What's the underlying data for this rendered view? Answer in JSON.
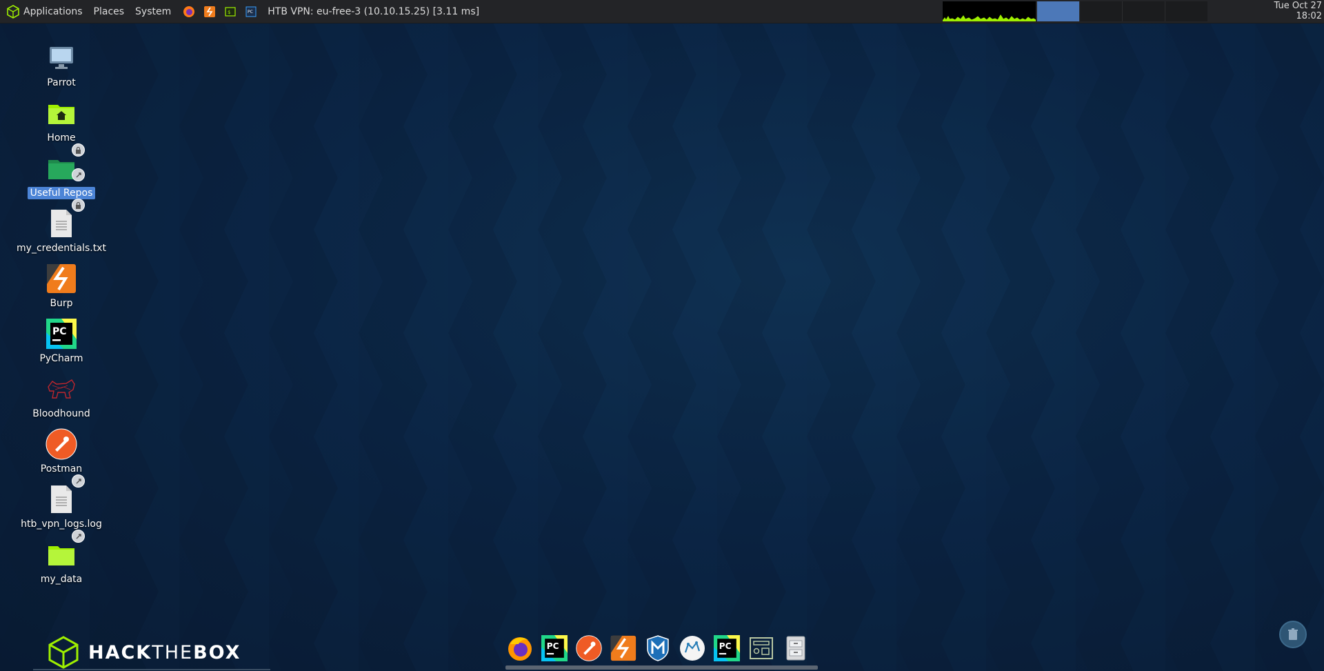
{
  "panel": {
    "menus": [
      "Applications",
      "Places",
      "System"
    ],
    "vpn_status": "HTB VPN: eu-free-3 (10.10.15.25) [3.11 ms]",
    "clock_date": "Tue Oct 27",
    "clock_time": "18:02",
    "launchers": [
      "firefox-icon",
      "burp-icon",
      "terminal-icon",
      "pycharm-icon"
    ]
  },
  "desktop": {
    "icons": [
      {
        "label": "Parrot"
      },
      {
        "label": "Home"
      },
      {
        "label": "Useful Repos"
      },
      {
        "label": "my_credentials.txt"
      },
      {
        "label": "Burp"
      },
      {
        "label": "PyCharm"
      },
      {
        "label": "Bloodhound"
      },
      {
        "label": "Postman"
      },
      {
        "label": "htb_vpn_logs.log"
      },
      {
        "label": "my_data"
      }
    ],
    "selected": "Useful Repos"
  },
  "logo": {
    "bold1": "HACK",
    "thin": "THE",
    "bold2": "BOX"
  },
  "dock": {
    "items": [
      "firefox",
      "pycharm",
      "postman",
      "burp",
      "metasploit",
      "bloodhound",
      "pycharm",
      "dashboard",
      "file-cabinet"
    ]
  },
  "colors": {
    "accent": "#9fef00",
    "selection": "#4c84d6",
    "panel": "#232427"
  }
}
